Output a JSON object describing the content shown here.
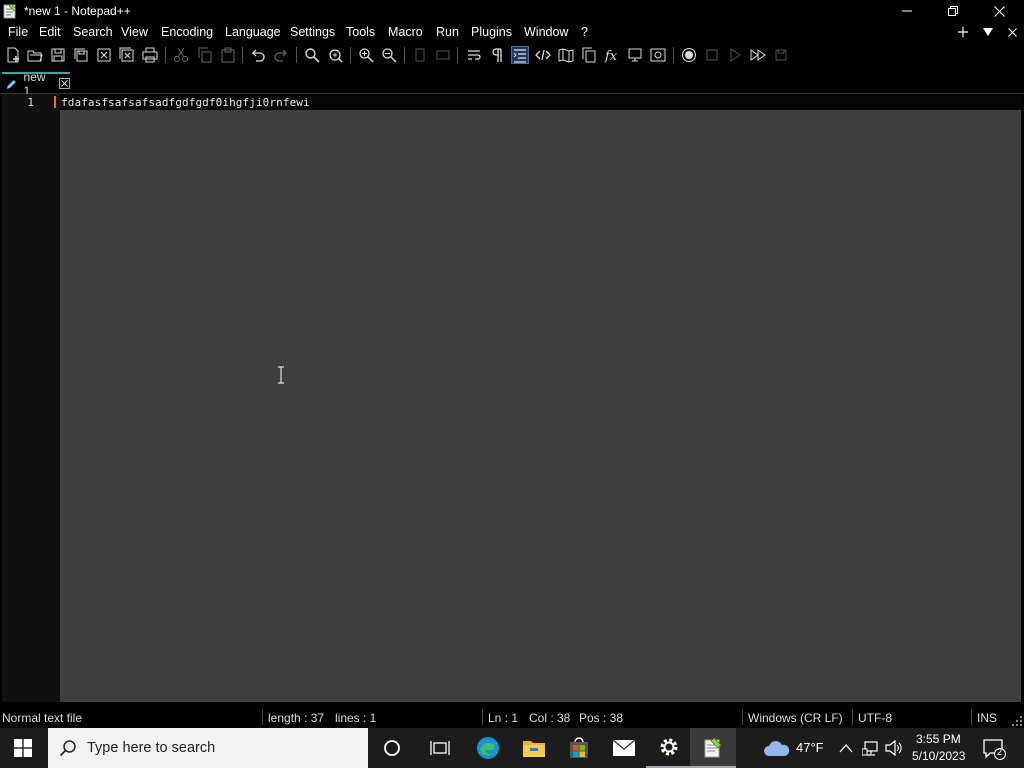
{
  "window": {
    "title": "*new 1 - Notepad++"
  },
  "menu": [
    "File",
    "Edit",
    "Search",
    "View",
    "Encoding",
    "Language",
    "Settings",
    "Tools",
    "Macro",
    "Run",
    "Plugins",
    "Window",
    "?"
  ],
  "tab": {
    "label": "new 1"
  },
  "editor": {
    "line_number": "1",
    "line_text": "fdafasfsafsafsadfgdfgdf0ihgfji0rnfewi"
  },
  "status": {
    "file_type": "Normal text file",
    "length": "length : 37",
    "lines": "lines : 1",
    "ln": "Ln : 1",
    "col": "Col : 38",
    "pos": "Pos : 38",
    "eol": "Windows (CR LF)",
    "encoding": "UTF-8",
    "mode": "INS"
  },
  "taskbar": {
    "search_placeholder": "Type here to search",
    "weather": "47°F",
    "time": "3:55 PM",
    "date": "5/10/2023",
    "notification_count": "2"
  },
  "colors": {
    "accent_orange": "#e07a20",
    "editor_bg": "#3f3f3f",
    "tab_accent": "#33aaaa"
  }
}
